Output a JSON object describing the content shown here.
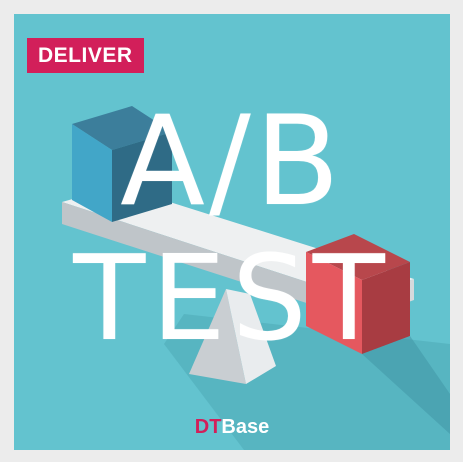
{
  "badge": {
    "label": "DELIVER"
  },
  "headline": {
    "line1": "A/B",
    "line2": "TEST"
  },
  "brand": {
    "prefix": "DT",
    "suffix": "Base"
  },
  "colors": {
    "background": "#63c3cf",
    "badge": "#d21f5a",
    "cube_a": "#3ea0c0",
    "cube_b": "#e0595e",
    "plank": "#d9dde0",
    "headline_text": "#ffffff"
  }
}
